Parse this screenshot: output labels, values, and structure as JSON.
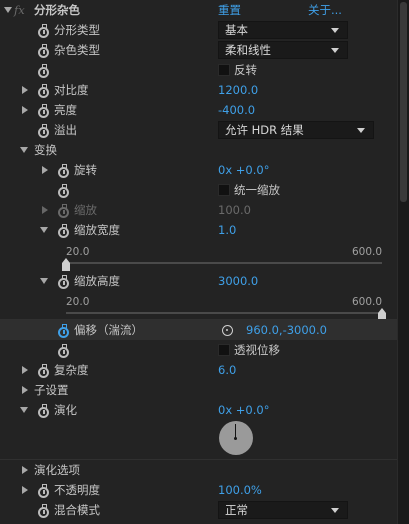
{
  "header": {
    "fx": "fx",
    "effect_name": "分形杂色",
    "reset_label": "重置",
    "about_label": "关于..."
  },
  "rows": {
    "fractal_type": {
      "label": "分形类型",
      "value": "基本"
    },
    "noise_type": {
      "label": "杂色类型",
      "value": "柔和线性"
    },
    "invert": {
      "label": "反转",
      "checked": false
    },
    "contrast": {
      "label": "对比度",
      "value": "1200.0"
    },
    "brightness": {
      "label": "亮度",
      "value": "-400.0"
    },
    "overflow": {
      "label": "溢出",
      "value": "允许 HDR 结果"
    },
    "transform": {
      "label": "变换"
    },
    "rotation": {
      "label": "旋转",
      "value": "0x +0.0°"
    },
    "uniform_scaling": {
      "label": "统一缩放",
      "checked": false
    },
    "scale": {
      "label": "缩放",
      "value": "100.0"
    },
    "scale_width": {
      "label": "缩放宽度",
      "value": "1.0",
      "slider_min": "20.0",
      "slider_max": "600.0",
      "slider_fraction": 0.0
    },
    "scale_height": {
      "label": "缩放高度",
      "value": "3000.0",
      "slider_min": "20.0",
      "slider_max": "600.0",
      "slider_fraction": 1.0
    },
    "offset": {
      "label": "偏移（湍流）",
      "value": "960.0,-3000.0"
    },
    "perspective_offset": {
      "label": "透视位移",
      "checked": false
    },
    "complexity": {
      "label": "复杂度",
      "value": "6.0"
    },
    "sub_settings": {
      "label": "子设置"
    },
    "evolution": {
      "label": "演化",
      "value": "0x +0.0°",
      "angle_deg": 0
    },
    "evolution_options": {
      "label": "演化选项"
    },
    "opacity": {
      "label": "不透明度",
      "value": "100.0%"
    },
    "blend_mode": {
      "label": "混合模式",
      "value": "正常"
    }
  }
}
